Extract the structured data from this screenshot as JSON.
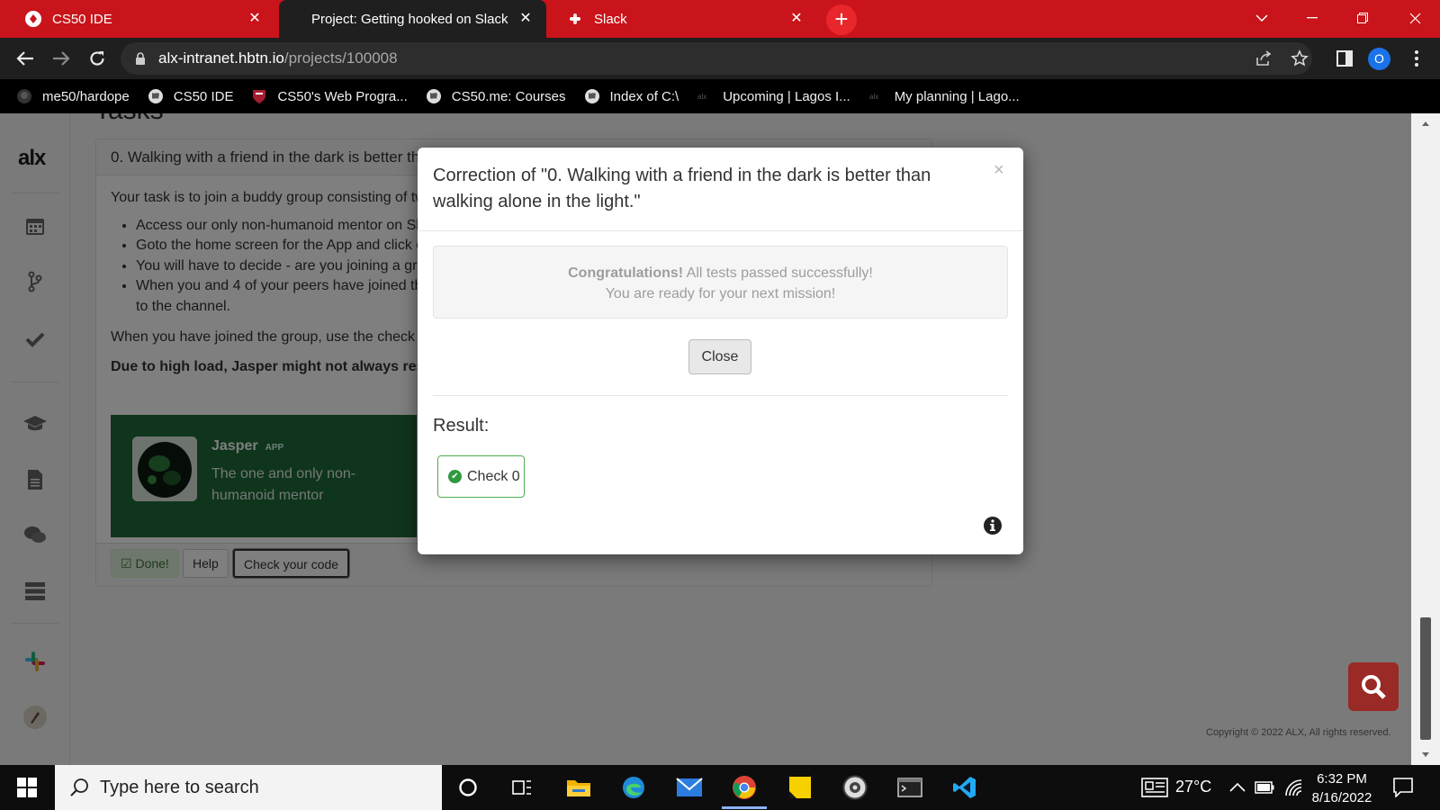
{
  "browser": {
    "tabs": [
      {
        "title": "CS50 IDE",
        "active": false
      },
      {
        "title": "Project: Getting hooked on Slack",
        "active": true
      },
      {
        "title": "Slack",
        "active": false
      }
    ],
    "url_host": "alx-intranet.hbtn.io",
    "url_path": "/projects/100008",
    "profile_initial": "O",
    "bookmarks": [
      {
        "label": "me50/hardope",
        "icon": "github-icon"
      },
      {
        "label": "CS50 IDE",
        "icon": "globe-icon"
      },
      {
        "label": "CS50's Web Progra...",
        "icon": "harvard-shield-icon"
      },
      {
        "label": "CS50.me: Courses",
        "icon": "globe-icon"
      },
      {
        "label": "Index of C:\\",
        "icon": "globe-icon"
      },
      {
        "label": "Upcoming | Lagos I...",
        "icon": "alx-icon"
      },
      {
        "label": "My planning | Lago...",
        "icon": "alx-icon"
      }
    ]
  },
  "page": {
    "logo": "alx",
    "heading": "Tasks",
    "task": {
      "title": "0. Walking with a friend in the dark is better than walking alone in the light.",
      "intro": "Your task is to join a buddy group consisting of two or more persons.",
      "bullets": [
        "Access our only non-humanoid mentor on Slack",
        "Goto the home screen for the App and click on the button",
        "You will have to decide - are you joining a group or creating one",
        "When you and 4 of your peers have joined the group, Jasper will invite you"
      ],
      "bullet_tail": "to the channel.",
      "outro": "When you have joined the group, use the check your code button.",
      "warning": "Due to high load, Jasper might not always respond immediately.",
      "jasper": {
        "name": "Jasper",
        "tag": "APP",
        "description": "The one and only non-humanoid mentor"
      },
      "buttons": {
        "done": "Done!",
        "help": "Help",
        "check": "Check your code"
      }
    },
    "copyright": "Copyright © 2022 ALX, All rights reserved."
  },
  "modal": {
    "title": "Correction of \"0. Walking with a friend in the dark is better than walking alone in the light.\"",
    "close_x": "×",
    "congrats_strong": "Congratulations!",
    "congrats_rest": " All tests passed successfully!",
    "congrats_line2": "You are ready for your next mission!",
    "close_button": "Close",
    "result_label": "Result:",
    "check_label": "Check 0",
    "check_status": "passed"
  },
  "taskbar": {
    "search_placeholder": "Type here to search",
    "temperature": "27°C",
    "time": "6:32 PM",
    "date": "8/16/2022"
  },
  "colors": {
    "tab_strip": "#c8141a",
    "check_success": "#2e9a3e",
    "jasper_card": "#1f6b38",
    "search_fab": "#9a2a25"
  }
}
